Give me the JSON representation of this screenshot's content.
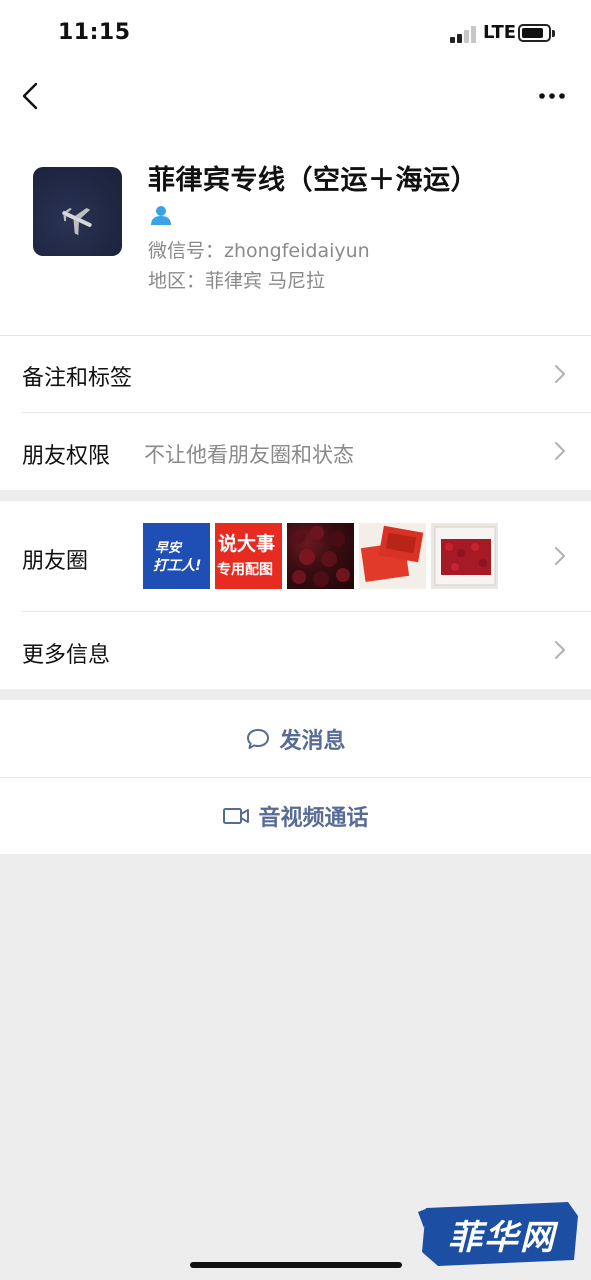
{
  "status_bar": {
    "time": "11:15",
    "network": "LTE",
    "icons": [
      "signal-icon",
      "battery-icon"
    ]
  },
  "nav": {
    "back_icon": "back-icon",
    "more_icon": "more-icon"
  },
  "profile": {
    "name": "菲律宾专线（空运＋海运）",
    "wechat_id": "微信号：zhongfeidaiyun",
    "region": "地区：菲律宾 马尼拉",
    "avatar_icon": "airplane-icon",
    "badge_icon": "contact-icon"
  },
  "rows": {
    "remark": {
      "label": "备注和标签"
    },
    "permissions": {
      "label": "朋友权限",
      "value": "不让他看朋友圈和状态"
    },
    "moments": {
      "label": "朋友圈",
      "thumbnails": [
        {
          "line1": "早安",
          "line2": "打工人!"
        },
        {
          "line1": "说大事",
          "line2": "专用配图"
        },
        {
          "line1": "",
          "line2": ""
        },
        {
          "line1": "",
          "line2": ""
        },
        {
          "line1": "",
          "line2": ""
        }
      ]
    },
    "more_info": {
      "label": "更多信息"
    }
  },
  "actions": {
    "send_message": {
      "label": "发消息",
      "icon": "message-icon"
    },
    "video_call": {
      "label": "音视频通话",
      "icon": "video-call-icon"
    }
  },
  "watermark": {
    "text": "菲华网"
  },
  "colors": {
    "link": "#576b95",
    "secondary_text": "#8a8a8a",
    "background": "#ededed",
    "watermark_blue": "#1c4ea3"
  }
}
